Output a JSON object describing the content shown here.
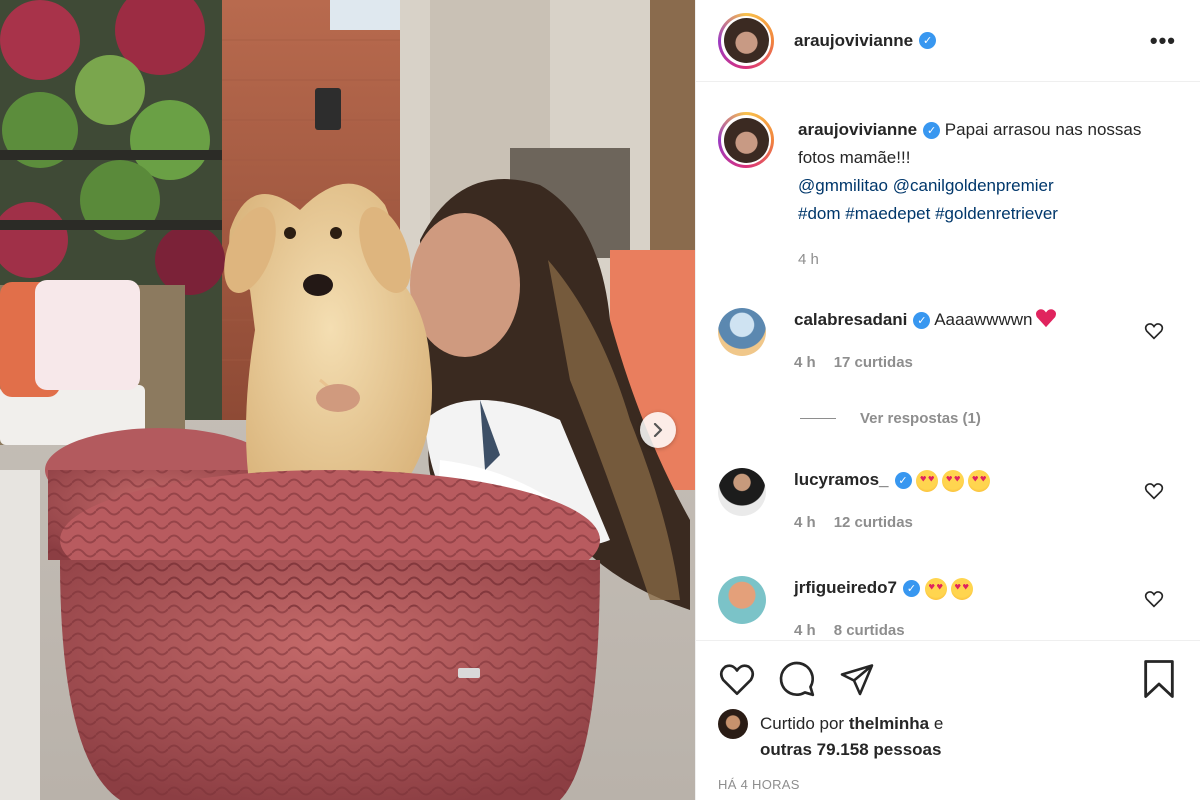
{
  "post": {
    "username": "araujovivianne",
    "more_label": "•••"
  },
  "caption": {
    "username": "araujovivianne",
    "text": "Papai arrasou nas nossas fotos mamãe!!!",
    "mention1": "@gmmilitao",
    "mention2": "@canilgoldenpremier",
    "tag1": "#dom",
    "tag2": "#maedepet",
    "tag3": "#goldenretriever",
    "time": "4 h"
  },
  "comments": [
    {
      "username": "calabresadani",
      "text": "Aaaawwwwn",
      "time": "4 h",
      "likes": "17 curtidas"
    },
    {
      "username": "lucyramos_",
      "text": "",
      "time": "4 h",
      "likes": "12 curtidas"
    },
    {
      "username": "jrfigueiredo7",
      "text": "",
      "time": "4 h",
      "likes": "8 curtidas"
    }
  ],
  "replies_label": "Ver respostas (1)",
  "liked_by": {
    "prefix": "Curtido por",
    "user": "thelminha",
    "connector": "e",
    "others": "outras 79.158 pessoas"
  },
  "timestamp": "HÁ 4 HORAS",
  "colors": {
    "link": "#00376b",
    "verified": "#3897f0",
    "meta": "#8e8e8e",
    "heart": "#e0245e"
  }
}
